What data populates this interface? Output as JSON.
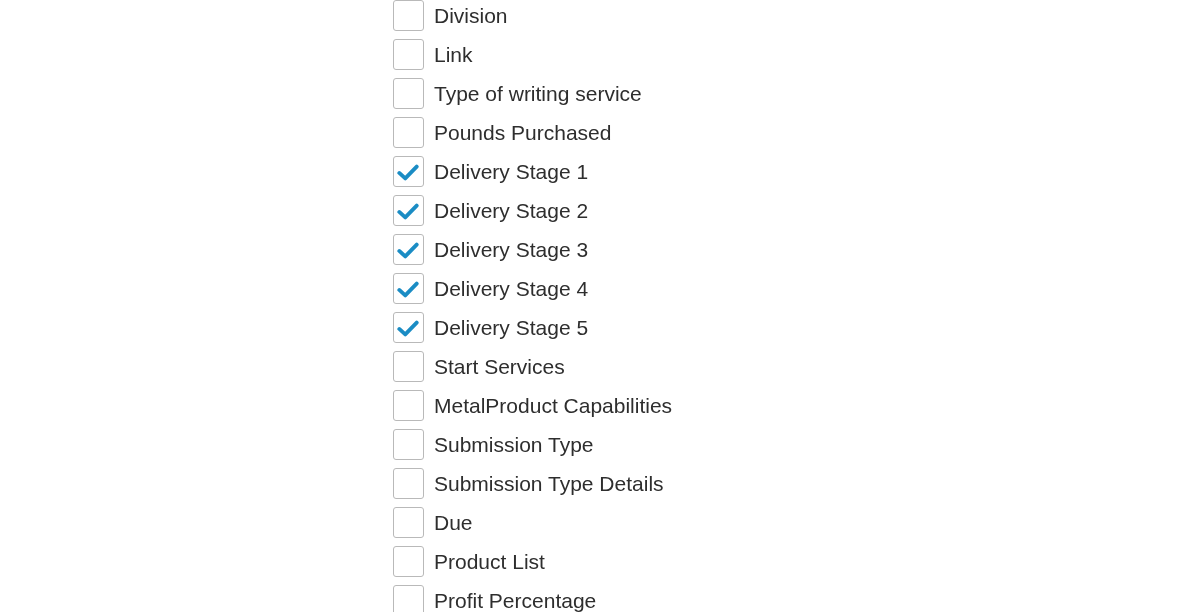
{
  "options": [
    {
      "label": "Division",
      "checked": false
    },
    {
      "label": "Link",
      "checked": false
    },
    {
      "label": "Type of writing service",
      "checked": false
    },
    {
      "label": "Pounds Purchased",
      "checked": false
    },
    {
      "label": "Delivery Stage 1",
      "checked": true
    },
    {
      "label": "Delivery Stage 2",
      "checked": true
    },
    {
      "label": "Delivery Stage 3",
      "checked": true
    },
    {
      "label": "Delivery Stage 4",
      "checked": true
    },
    {
      "label": "Delivery Stage 5",
      "checked": true
    },
    {
      "label": "Start Services",
      "checked": false
    },
    {
      "label": "MetalProduct Capabilities",
      "checked": false
    },
    {
      "label": "Submission Type",
      "checked": false
    },
    {
      "label": "Submission Type Details",
      "checked": false
    },
    {
      "label": "Due",
      "checked": false
    },
    {
      "label": "Product List",
      "checked": false
    },
    {
      "label": "Profit Percentage",
      "checked": false
    }
  ]
}
